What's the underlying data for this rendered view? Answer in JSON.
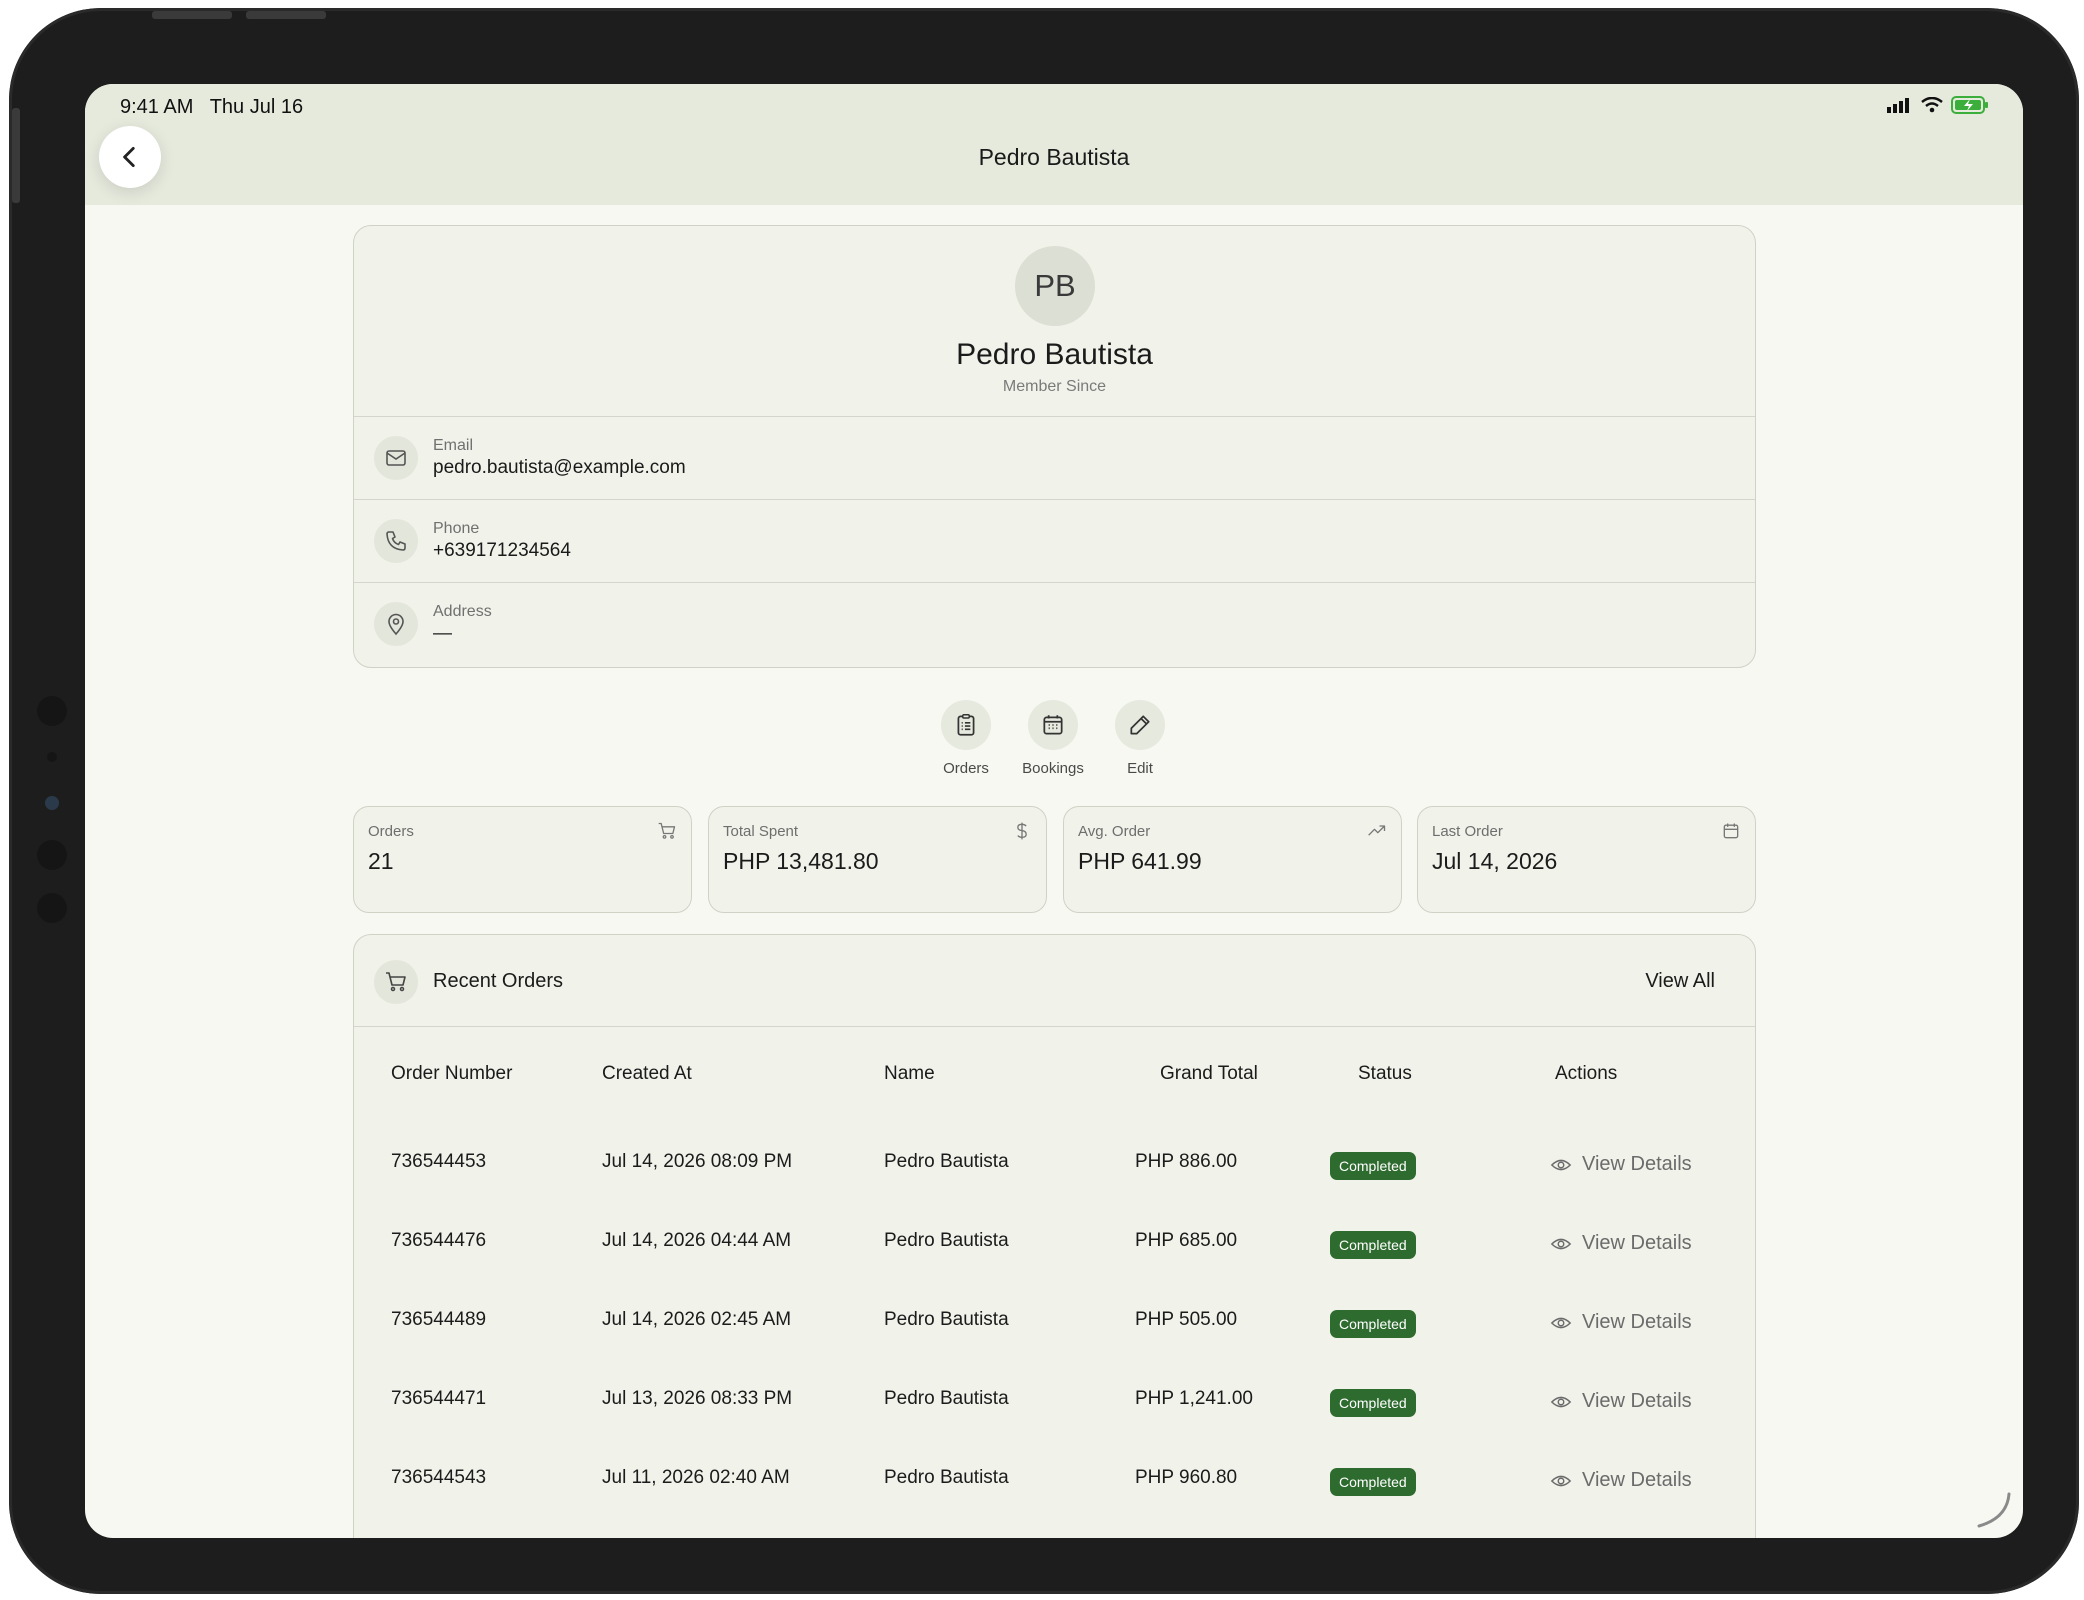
{
  "status_bar": {
    "time": "9:41 AM",
    "date": "Thu Jul 16"
  },
  "header": {
    "title": "Pedro Bautista",
    "back_icon": "chevron-left-icon"
  },
  "profile": {
    "initials": "PB",
    "name": "Pedro Bautista",
    "member_since_label": "Member Since",
    "email_label": "Email",
    "email": "pedro.bautista@example.com",
    "phone_label": "Phone",
    "phone": "+639171234564",
    "address_label": "Address",
    "address": "—"
  },
  "quick_actions": [
    {
      "label": "Orders",
      "icon": "clipboard-list-icon"
    },
    {
      "label": "Bookings",
      "icon": "calendar-icon"
    },
    {
      "label": "Edit",
      "icon": "pencil-icon"
    }
  ],
  "stats": [
    {
      "label": "Orders",
      "value": "21",
      "icon": "cart-icon"
    },
    {
      "label": "Total Spent",
      "value": "PHP 13,481.80",
      "icon": "dollar-icon"
    },
    {
      "label": "Avg. Order",
      "value": "PHP 641.99",
      "icon": "trending-up-icon"
    },
    {
      "label": "Last Order",
      "value": "Jul 14, 2026",
      "icon": "calendar-icon"
    }
  ],
  "recent_orders": {
    "title": "Recent Orders",
    "view_all": "View All",
    "columns": [
      "Order Number",
      "Created At",
      "Name",
      "Grand Total",
      "Status",
      "Actions"
    ],
    "rows": [
      {
        "order_number": "736544453",
        "created_at": "Jul 14, 2026 08:09 PM",
        "name": "Pedro Bautista",
        "grand_total": "PHP 886.00",
        "status": "Completed",
        "action": "View Details"
      },
      {
        "order_number": "736544476",
        "created_at": "Jul 14, 2026 04:44 AM",
        "name": "Pedro Bautista",
        "grand_total": "PHP 685.00",
        "status": "Completed",
        "action": "View Details"
      },
      {
        "order_number": "736544489",
        "created_at": "Jul 14, 2026 02:45 AM",
        "name": "Pedro Bautista",
        "grand_total": "PHP 505.00",
        "status": "Completed",
        "action": "View Details"
      },
      {
        "order_number": "736544471",
        "created_at": "Jul 13, 2026 08:33 PM",
        "name": "Pedro Bautista",
        "grand_total": "PHP 1,241.00",
        "status": "Completed",
        "action": "View Details"
      },
      {
        "order_number": "736544543",
        "created_at": "Jul 11, 2026 02:40 AM",
        "name": "Pedro Bautista",
        "grand_total": "PHP 960.80",
        "status": "Completed",
        "action": "View Details"
      }
    ]
  },
  "colors": {
    "header_bg": "#e6eadd",
    "page_bg": "#f7f8f1",
    "card_bg": "#f1f2ea",
    "status_completed": "#2e6b2f",
    "battery": "#3cae3c"
  }
}
